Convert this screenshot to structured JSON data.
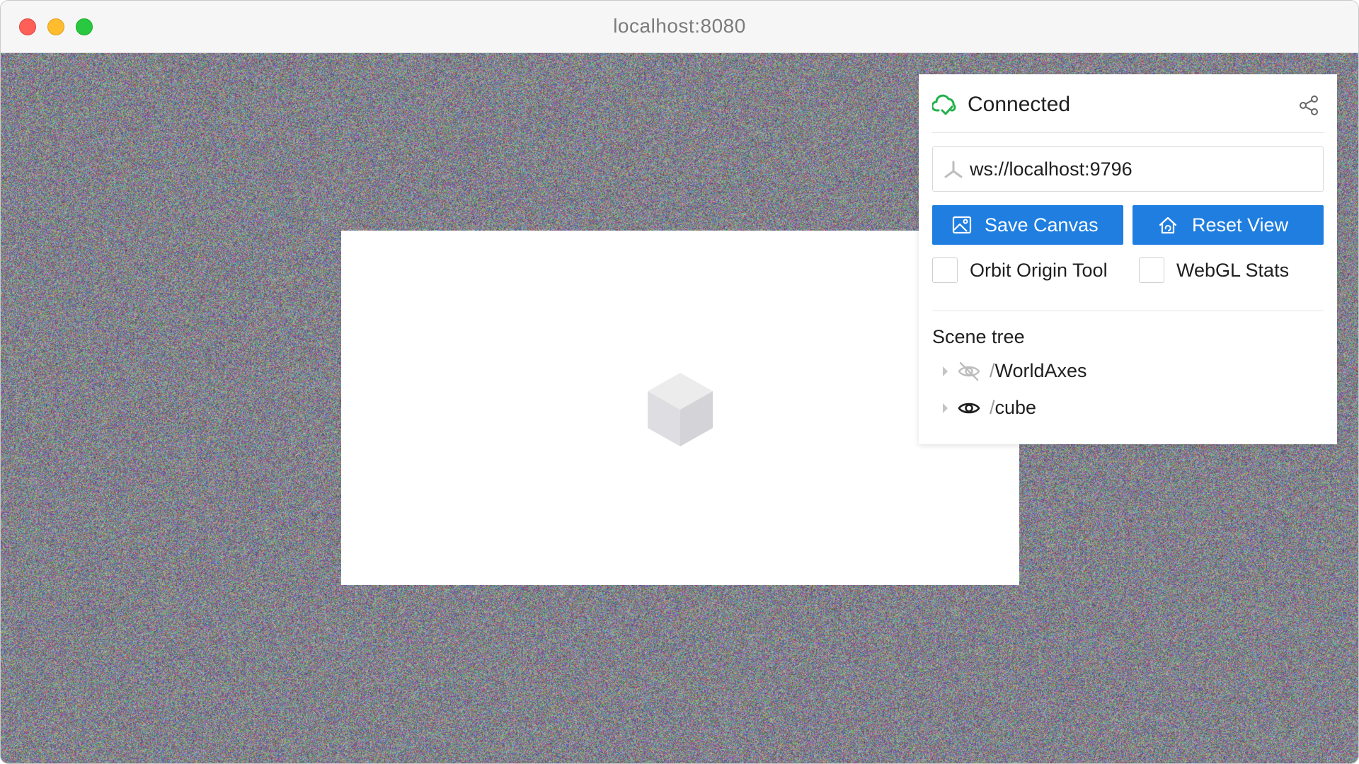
{
  "window": {
    "title": "localhost:8080"
  },
  "panel": {
    "status": "Connected",
    "status_color": "#22b14c",
    "status_icon": "cloud-check-icon",
    "share_icon": "share-icon",
    "url_field": {
      "value": "ws://localhost:9796",
      "icon": "server-icon"
    },
    "buttons": {
      "save_canvas": "Save Canvas",
      "reset_view": "Reset View",
      "accent_color": "#1f7ee0"
    },
    "checkboxes": [
      {
        "label": "Orbit Origin Tool",
        "checked": false
      },
      {
        "label": "WebGL Stats",
        "checked": false
      }
    ],
    "scene_tree": {
      "title": "Scene tree",
      "nodes": [
        {
          "slash": "/",
          "name": "WorldAxes",
          "visible": false,
          "icon": "eye-off-icon"
        },
        {
          "slash": "/",
          "name": "cube",
          "visible": true,
          "icon": "eye-icon"
        }
      ]
    }
  }
}
